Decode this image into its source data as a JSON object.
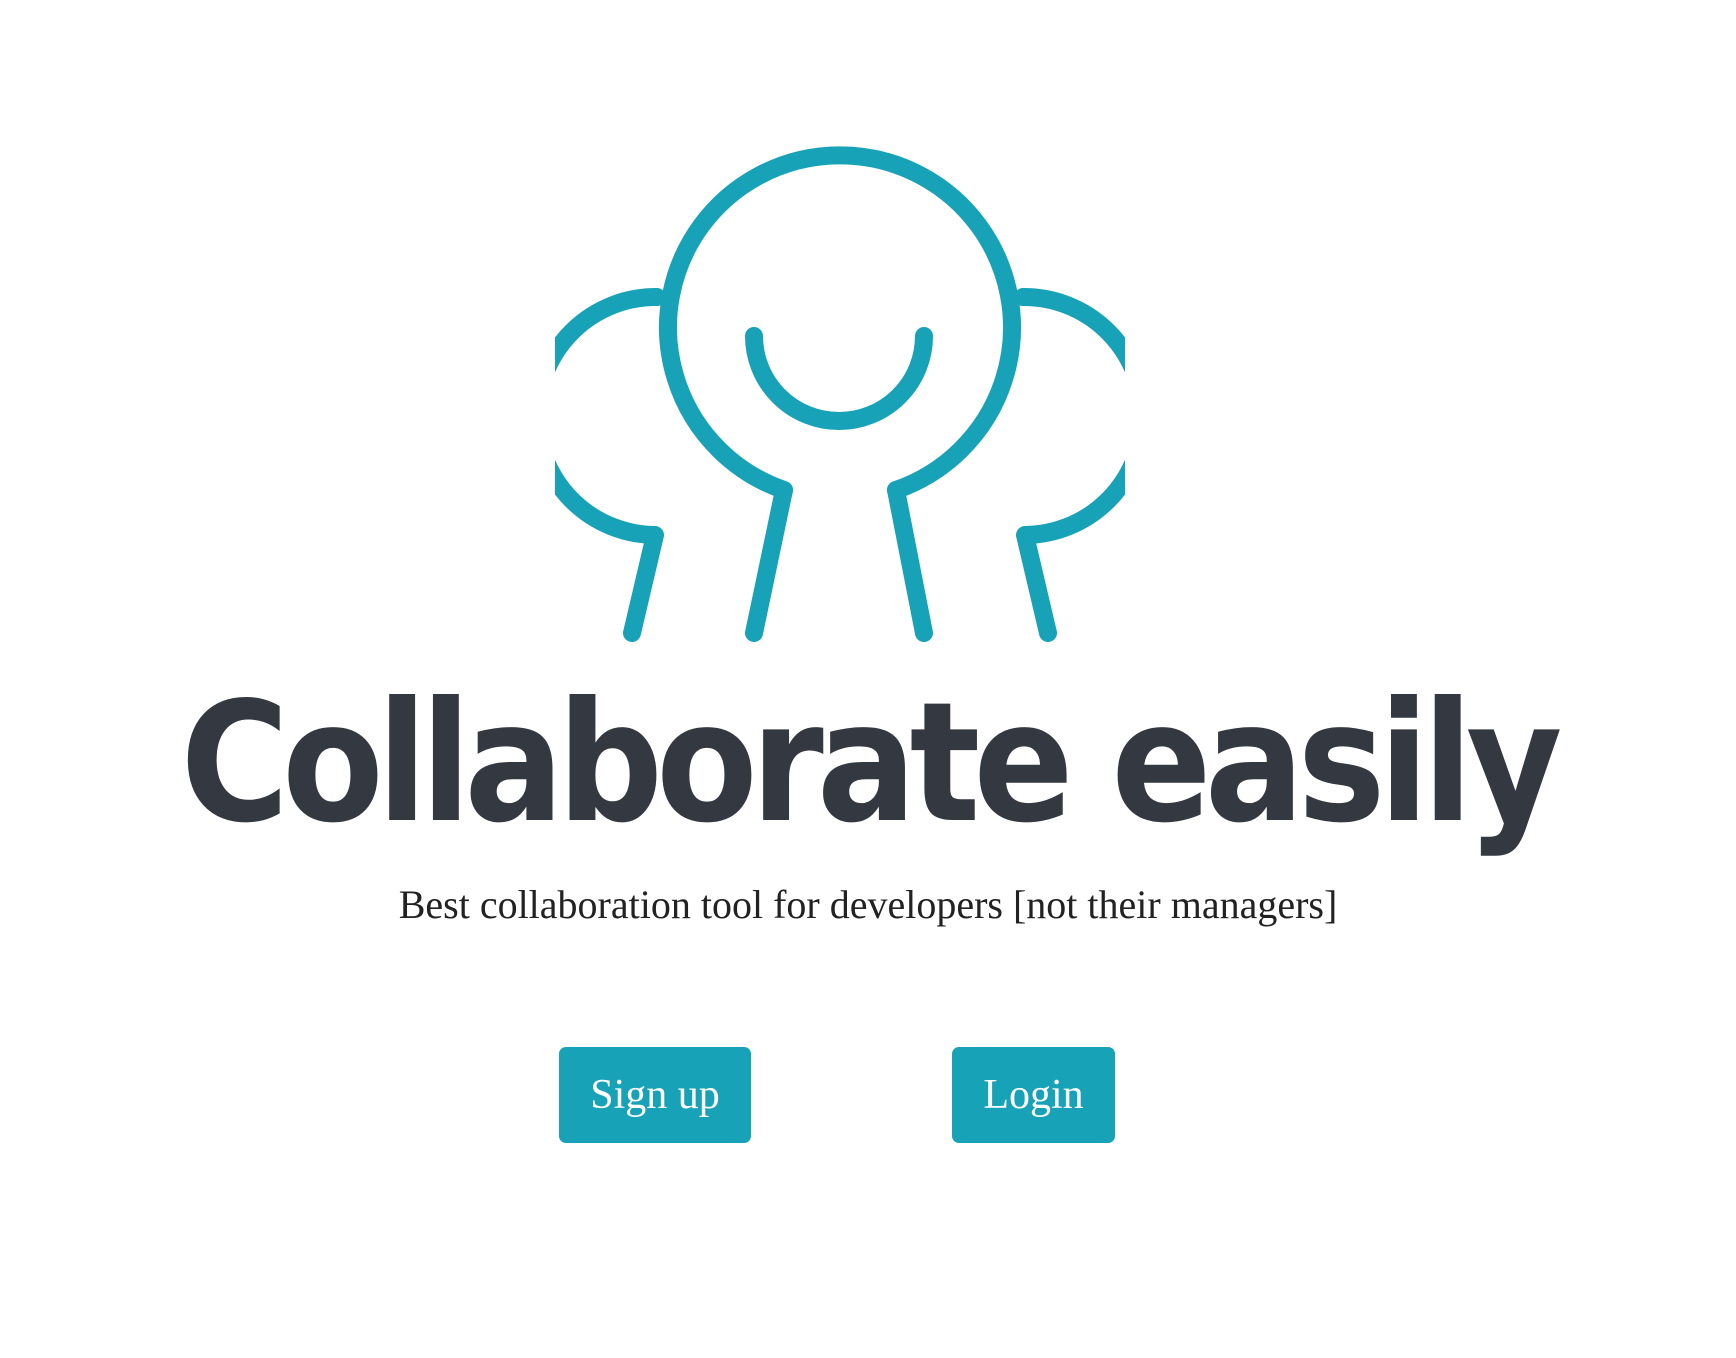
{
  "brand": {
    "accent_color": "#17a2b8",
    "text_color": "#343941",
    "logo_icon": "people-collaboration-icon"
  },
  "hero": {
    "headline": "Collaborate easily",
    "tagline": "Best collaboration tool for developers [not their managers]"
  },
  "actions": {
    "signup_label": "Sign up",
    "login_label": "Login"
  }
}
